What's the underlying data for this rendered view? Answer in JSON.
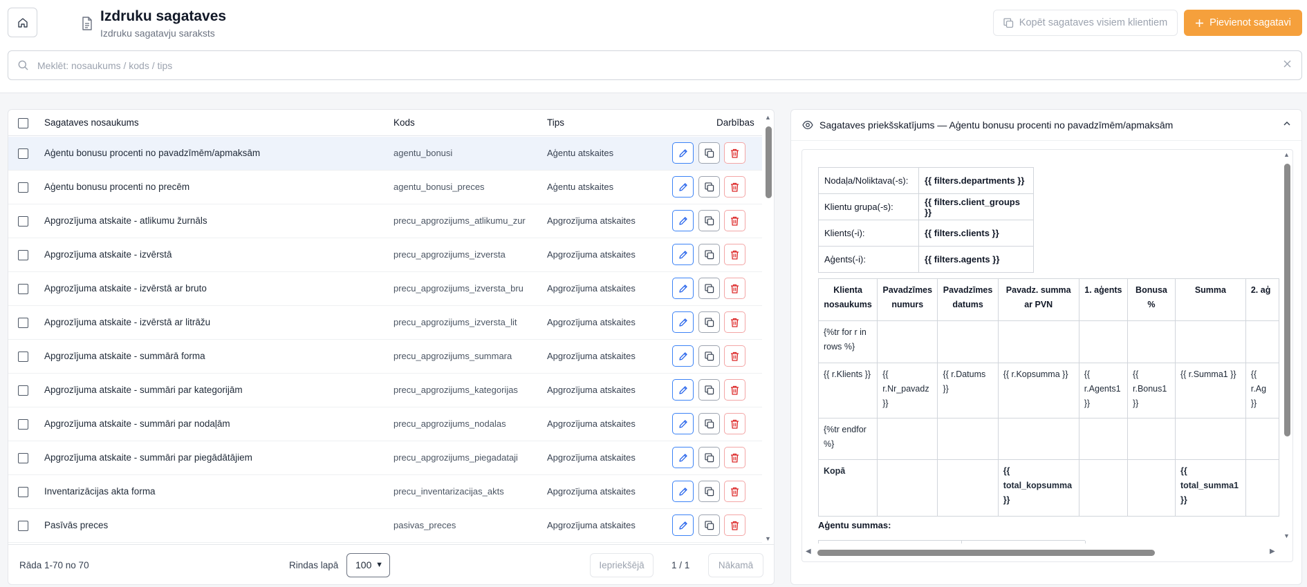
{
  "header": {
    "title": "Izdruku sagataves",
    "subtitle": "Izdruku sagatavju saraksts",
    "copy_all_label": "Kopēt sagataves visiem klientiem",
    "add_label": "Pievienot sagatavi"
  },
  "search": {
    "placeholder": "Meklēt: nosaukums / kods / tips",
    "value": ""
  },
  "table": {
    "columns": {
      "name": "Sagataves nosaukums",
      "code": "Kods",
      "type": "Tips",
      "actions": "Darbības"
    },
    "rows": [
      {
        "name": "Aģentu bonusu procenti no pavadzīmēm/apmaksām",
        "code": "agentu_bonusi",
        "type": "Aģentu atskaites"
      },
      {
        "name": "Aģentu bonusu procenti no precēm",
        "code": "agentu_bonusi_preces",
        "type": "Aģentu atskaites"
      },
      {
        "name": "Apgrozījuma atskaite - atlikumu žurnāls",
        "code": "precu_apgrozijums_atlikumu_zur",
        "type": "Apgrozījuma atskaites"
      },
      {
        "name": "Apgrozījuma atskaite - izvērstā",
        "code": "precu_apgrozijums_izversta",
        "type": "Apgrozījuma atskaites"
      },
      {
        "name": "Apgrozījuma atskaite - izvērstā ar bruto",
        "code": "precu_apgrozijums_izversta_bru",
        "type": "Apgrozījuma atskaites"
      },
      {
        "name": "Apgrozījuma atskaite - izvērstā ar litrāžu",
        "code": "precu_apgrozijums_izversta_lit",
        "type": "Apgrozījuma atskaites"
      },
      {
        "name": "Apgrozījuma atskaite - summārā forma",
        "code": "precu_apgrozijums_summara",
        "type": "Apgrozījuma atskaites"
      },
      {
        "name": "Apgrozījuma atskaite - summāri par kategorijām",
        "code": "precu_apgrozijums_kategorijas",
        "type": "Apgrozījuma atskaites"
      },
      {
        "name": "Apgrozījuma atskaite - summāri par nodaļām",
        "code": "precu_apgrozijums_nodalas",
        "type": "Apgrozījuma atskaites"
      },
      {
        "name": "Apgrozījuma atskaite - summāri par piegādātājiem",
        "code": "precu_apgrozijums_piegadataji",
        "type": "Apgrozījuma atskaites"
      },
      {
        "name": "Inventarizācijas akta forma",
        "code": "precu_inventarizacijas_akts",
        "type": "Apgrozījuma atskaites"
      },
      {
        "name": "Pasīvās preces",
        "code": "pasivas_preces",
        "type": "Apgrozījuma atskaites"
      }
    ]
  },
  "footer": {
    "showing": "Rāda 1-70 no 70",
    "rows_per_page_label": "Rindas lapā",
    "rows_per_page_value": "100",
    "prev_label": "Iepriekšējā",
    "page_indicator": "1 / 1",
    "next_label": "Nākamā"
  },
  "preview": {
    "title": "Sagataves priekšskatījums — Aģentu bonusu procenti no pavadzīmēm/apmaksām",
    "filters": [
      {
        "label": "Nodaļa/Noliktava(-s):",
        "value": "{{ filters.departments }}"
      },
      {
        "label": "Klientu grupa(-s):",
        "value": "{{ filters.client_groups }}"
      },
      {
        "label": "Klients(-i):",
        "value": "{{ filters.clients }}"
      },
      {
        "label": "Aģents(-i):",
        "value": "{{ filters.agents }}"
      }
    ],
    "headers": [
      "Klienta nosaukums",
      "Pavadzīmes numurs",
      "Pavadzīmes datums",
      "Pavadz. summa ar PVN",
      "1. aģents",
      "Bonusa %",
      "Summa",
      "2. aģ"
    ],
    "row_for": "{%tr for r in rows %}",
    "row_data": [
      "{{ r.Klients }}",
      "{{ r.Nr_pavadz }}",
      "{{ r.Datums }}",
      "{{ r.Kopsumma }}",
      "{{ r.Agents1 }}",
      "{{ r.Bonus1 }}",
      "{{ r.Summa1 }}",
      "{{ r.Ag }}"
    ],
    "row_endfor": "{%tr endfor %}",
    "total_label": "Kopā",
    "total_kopsumma": "{{ total_kopsumma }}",
    "total_summa1": "{{ total_summa1 }}",
    "agent_sums_label": "Aģentu summas:"
  },
  "colors": {
    "accent_orange": "#f5a03c",
    "edit_blue": "#3b82f6",
    "delete_red": "#dc2626",
    "selected_row": "#eef3fb"
  }
}
